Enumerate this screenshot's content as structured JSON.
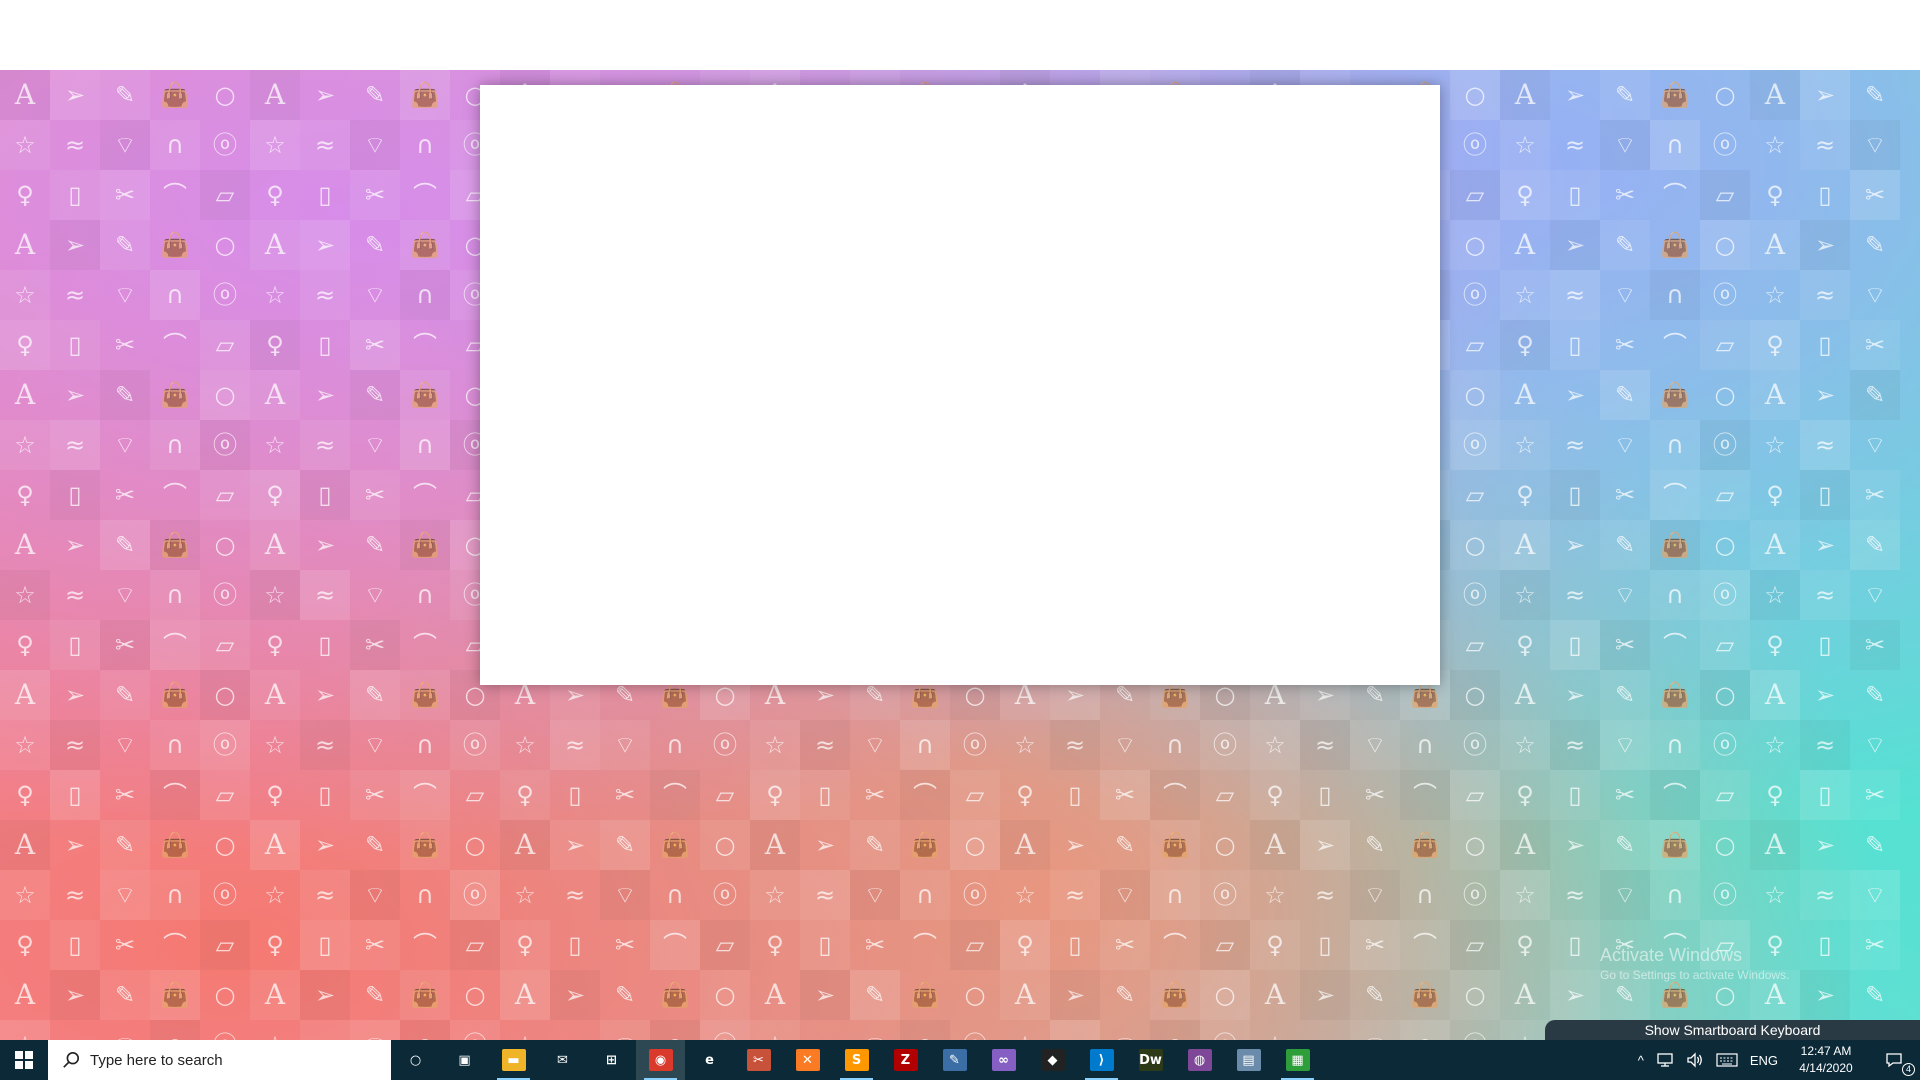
{
  "desktop": {
    "wallpaper_icons": [
      "letter-a",
      "paper-plane",
      "pencil",
      "handbag",
      "circle",
      "star",
      "sneaker",
      "wifi",
      "headphones",
      "apple",
      "globe",
      "ipod",
      "scissors",
      "skateboard",
      "eraser"
    ],
    "watermark_title": "Activate Windows",
    "watermark_subtitle": "Go to Settings to activate Windows."
  },
  "window": {
    "background": "#ffffff"
  },
  "smartboard": {
    "label": "Show Smartboard Keyboard"
  },
  "taskbar": {
    "search_placeholder": "Type here to search",
    "apps": [
      {
        "name": "cortana",
        "glyph": "○",
        "color": "transparent"
      },
      {
        "name": "task-view",
        "glyph": "▣",
        "color": "transparent"
      },
      {
        "name": "file-explorer",
        "glyph": "▬",
        "color": "#f0b429"
      },
      {
        "name": "mail",
        "glyph": "✉",
        "color": "transparent"
      },
      {
        "name": "store",
        "glyph": "⊞",
        "color": "transparent"
      },
      {
        "name": "chrome",
        "glyph": "◉",
        "color": "#d93a2b"
      },
      {
        "name": "edge",
        "glyph": "e",
        "color": "transparent"
      },
      {
        "name": "snipping",
        "glyph": "✂",
        "color": "#c8513a"
      },
      {
        "name": "xampp",
        "glyph": "✕",
        "color": "#fb7a24"
      },
      {
        "name": "sublime",
        "glyph": "S",
        "color": "#ff9800"
      },
      {
        "name": "filezilla",
        "glyph": "Z",
        "color": "#b00000"
      },
      {
        "name": "ssms",
        "glyph": "✎",
        "color": "#3b6ea5"
      },
      {
        "name": "visual-studio",
        "glyph": "∞",
        "color": "#865fc5"
      },
      {
        "name": "unity",
        "glyph": "◆",
        "color": "#222222"
      },
      {
        "name": "vscode",
        "glyph": "⟩",
        "color": "#007acc"
      },
      {
        "name": "dreamweaver",
        "glyph": "Dw",
        "color": "#2d3a18"
      },
      {
        "name": "tor",
        "glyph": "◍",
        "color": "#7e4798"
      },
      {
        "name": "remote",
        "glyph": "▤",
        "color": "#6a8caa"
      },
      {
        "name": "notepad-green",
        "glyph": "▦",
        "color": "#2e9e3a"
      }
    ],
    "tray": {
      "chevron": "^",
      "language": "ENG",
      "time": "12:47 AM",
      "date": "4/14/2020",
      "notifications": "4"
    }
  }
}
